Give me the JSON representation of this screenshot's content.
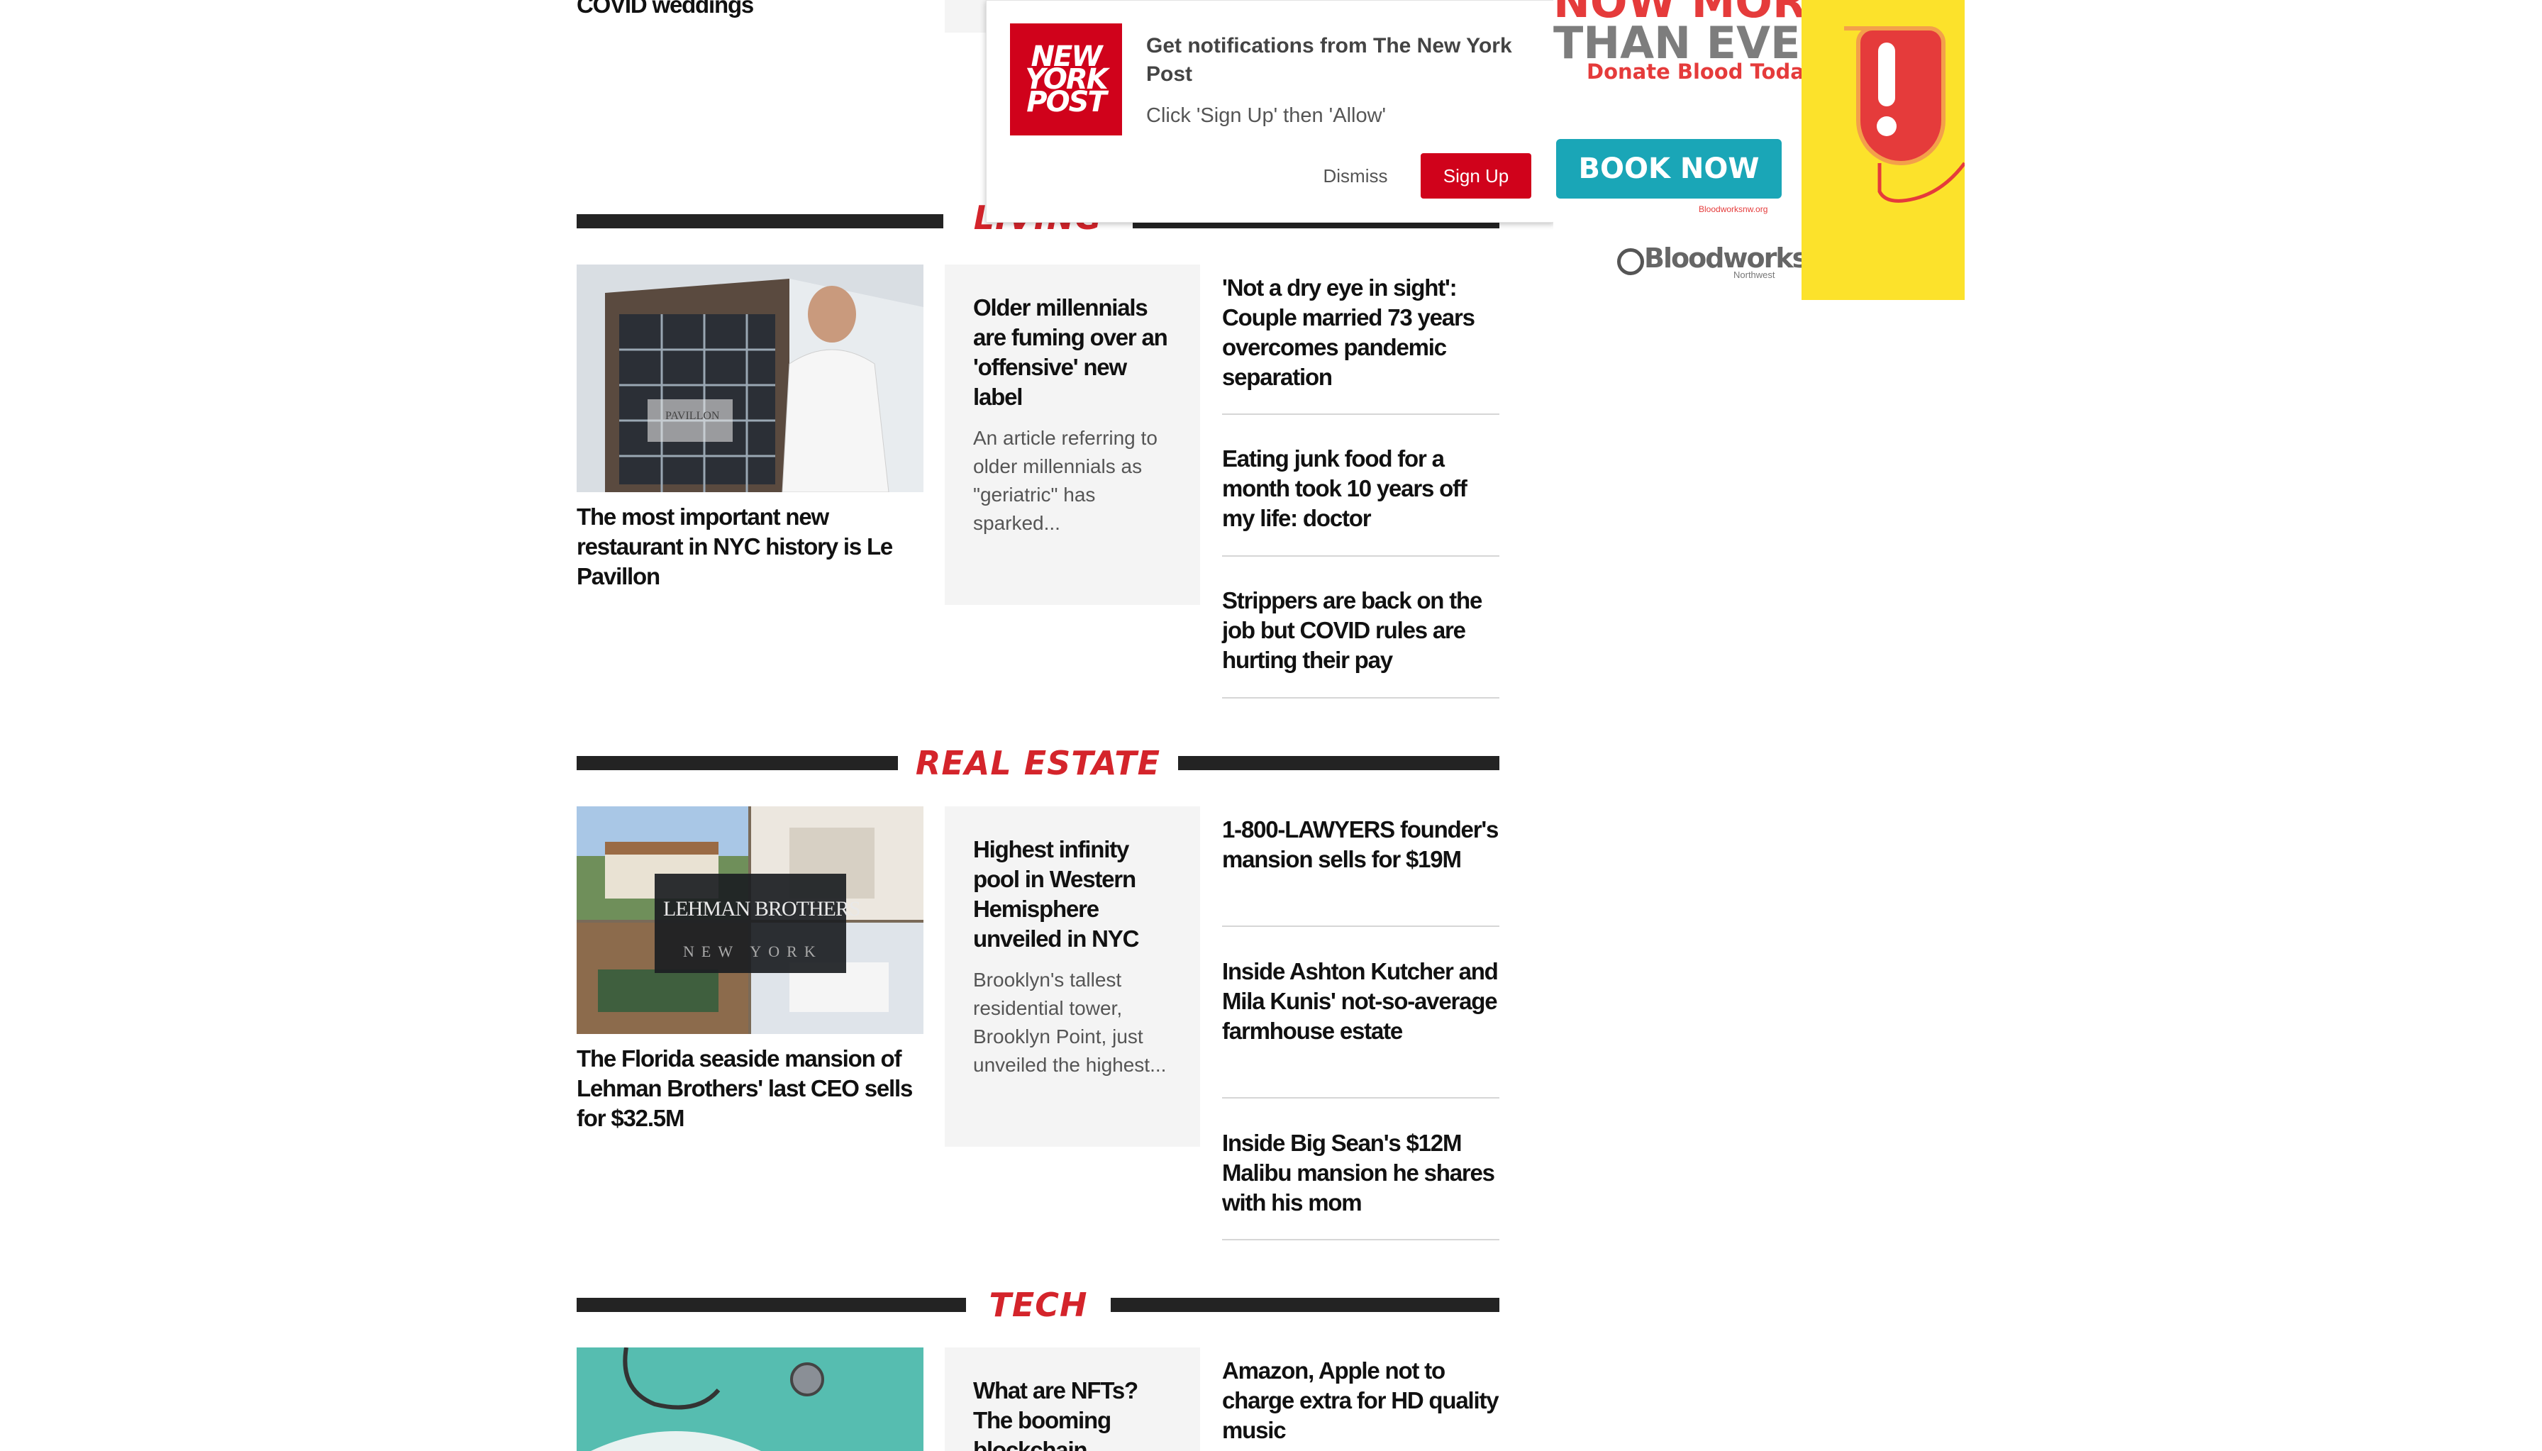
{
  "top": {
    "prev_headline": "COVID weddings"
  },
  "notification": {
    "title": "Get notifications from The New York Post",
    "subtitle": "Click 'Sign Up' then 'Allow'",
    "dismiss_label": "Dismiss",
    "signup_label": "Sign Up",
    "logo_lines": [
      "NEW",
      "YORK",
      "POST"
    ]
  },
  "ad": {
    "line1": "NOW MORE",
    "line2": "THAN EVER",
    "tagline": "Donate Blood Today.",
    "button": "BOOK NOW",
    "url": "Bloodworksnw.org",
    "brand": "Bloodworks",
    "brand_sub": "Northwest"
  },
  "sections": [
    {
      "title": "LIVING",
      "main": {
        "headline": "The most important new restaurant in NYC history is Le Pavillon",
        "image_label": "PAVILLON"
      },
      "card": {
        "headline": "Older millennials are fuming over an 'offensive' new label",
        "excerpt": "An article referring to older millennials as \"geriatric\" has sparked..."
      },
      "side": [
        "'Not a dry eye in sight': Couple married 73 years overcomes pandemic separation",
        "Eating junk food for a month took 10 years off my life: doctor",
        "Strippers are back on the job but COVID rules are hurting their pay"
      ]
    },
    {
      "title": "REAL ESTATE",
      "main": {
        "headline": "The Florida seaside mansion of Lehman Brothers' last CEO sells for $32.5M",
        "image_label": "LEHMAN BROTHERS",
        "image_label2": "NEW YORK"
      },
      "card": {
        "headline": "Highest infinity pool in Western Hemisphere unveiled in NYC",
        "excerpt": "Brooklyn's tallest residential tower, Brooklyn Point, just unveiled the highest..."
      },
      "side": [
        "1-800-LAWYERS founder's mansion sells for $19M",
        "Inside Ashton Kutcher and Mila Kunis' not-so-average farmhouse estate",
        "Inside Big Sean's $12M Malibu mansion he shares with his mom"
      ]
    },
    {
      "title": "TECH",
      "main": {
        "headline": ""
      },
      "card": {
        "headline": "What are NFTs? The booming blockchain"
      },
      "side": [
        "Amazon, Apple not to charge extra for HD quality music"
      ]
    }
  ]
}
